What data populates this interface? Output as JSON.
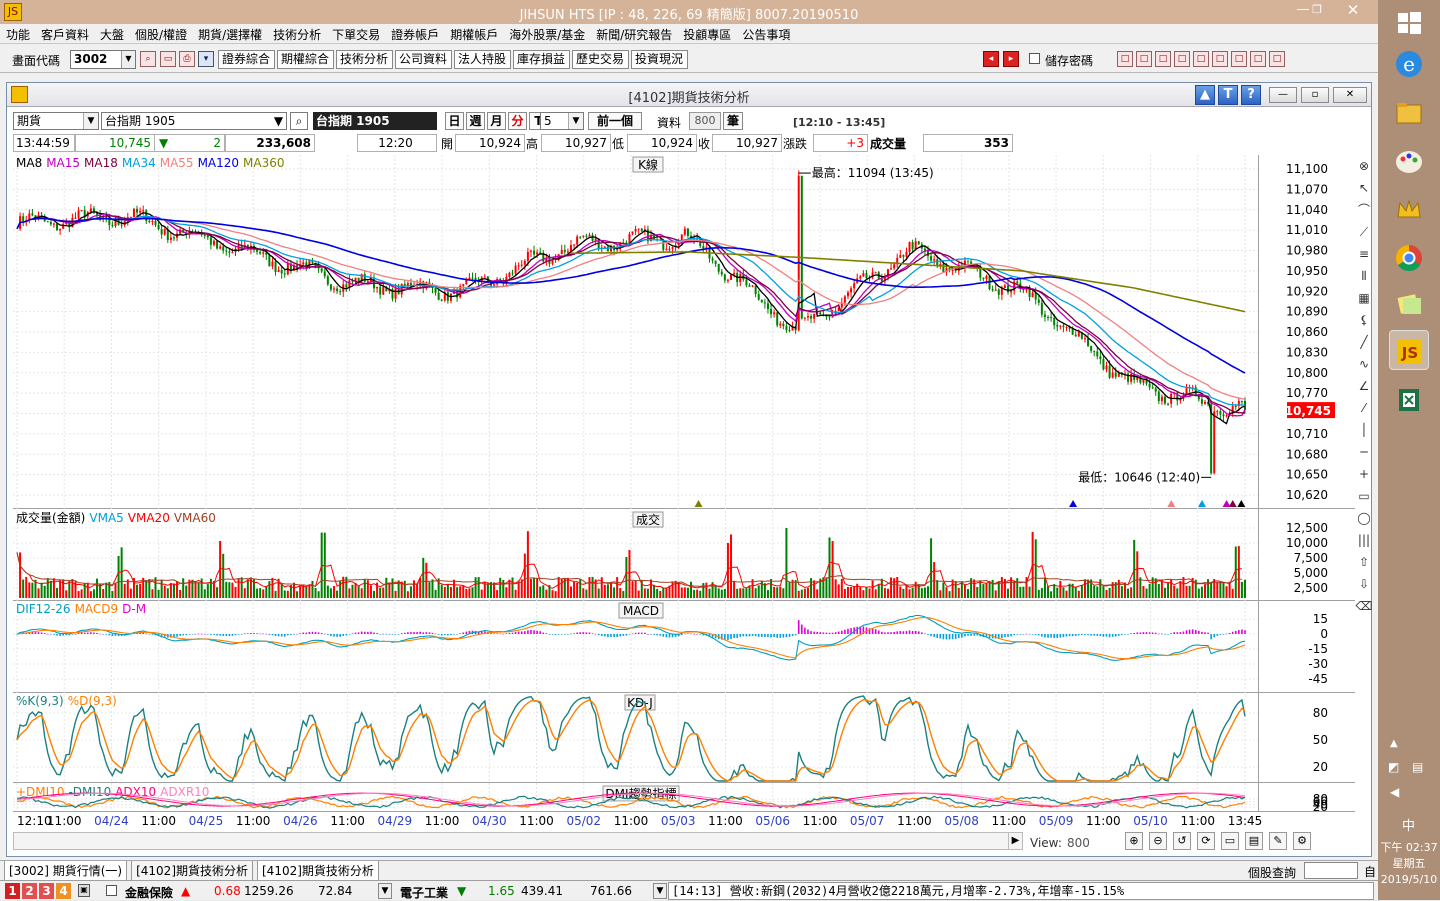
{
  "window": {
    "title": "JIHSUN HTS      [IP : 48, 226, 69 精簡版] 8007.20190510",
    "logo": "JS"
  },
  "menu": [
    "功能",
    "客戶資料",
    "大盤",
    "個股/權證",
    "期貨/選擇權",
    "技術分析",
    "下單交易",
    "證券帳戶",
    "期權帳戶",
    "海外股票/基金",
    "新聞/研究報告",
    "投顧專區",
    "公告事項"
  ],
  "toolbar": {
    "code_label": "畫面代碼",
    "code_value": "3002",
    "buttons": [
      "證券綜合",
      "期權綜合",
      "技術分析",
      "公司資料",
      "法人持股",
      "庫存損益",
      "歷史交易",
      "投資現況"
    ],
    "save_password": "儲存密碼"
  },
  "child": {
    "title": "[4102]期貨技術分析",
    "help_icons": [
      "▲",
      "T",
      "?"
    ]
  },
  "controls": {
    "market": "期貨",
    "symbol": "台指期 1905",
    "symbol_display": "台指期 1905",
    "periods": [
      "日",
      "週",
      "月",
      "分",
      "T"
    ],
    "active_period": "分",
    "interval": "5",
    "prev": "前一個",
    "data_label": "資料",
    "data_count": "800",
    "unit": "筆",
    "time_range": "[12:10 - 13:45]"
  },
  "quote": {
    "time": "13:44:59",
    "price": "10,745",
    "change_arrow": "▼",
    "change": "2",
    "volume": "233,608",
    "bar_time": "12:20",
    "open_label": "開",
    "open": "10,924",
    "high_label": "高",
    "high": "10,927",
    "low_label": "低",
    "low": "10,924",
    "close_label": "收",
    "close": "10,927",
    "chg_label": "漲跌",
    "chg": "+3",
    "vol_label": "成交量",
    "vol": "353"
  },
  "colors": {
    "up": "#ff0000",
    "down": "#008000",
    "ma8": "#000000",
    "ma15": "#c000c0",
    "ma18": "#800040",
    "ma34": "#00a0e0",
    "ma55": "#f08080",
    "ma120": "#0000e0",
    "ma360": "#808000",
    "dif": "#00a0c0",
    "macd": "#ff8000",
    "k": "#1a8080",
    "d": "#ff8000",
    "pdi": "#ff8000",
    "mdi": "#1a8080",
    "adx": "#ff0080",
    "adxr": "#ff80c0"
  },
  "panels": {
    "kline": {
      "title": "K線",
      "legend": [
        "MA8",
        "MA15",
        "MA18",
        "MA34",
        "MA55",
        "MA120",
        "MA360"
      ],
      "yticks": [
        "11,100",
        "11,070",
        "11,040",
        "11,010",
        "10,980",
        "10,950",
        "10,920",
        "10,890",
        "10,860",
        "10,830",
        "10,800",
        "10,770",
        "10,740",
        "10,710",
        "10,680",
        "10,650",
        "10,620"
      ],
      "high_note": "最高：11094 (13:45)",
      "low_note": "最低：10646 (12:40)",
      "last": "10,745"
    },
    "volume": {
      "title": "成交",
      "legend": [
        "成交量(金額)",
        "VMA5",
        "VMA20",
        "VMA60"
      ],
      "yticks": [
        "12,500",
        "10,000",
        "7,500",
        "5,000",
        "2,500"
      ]
    },
    "macd": {
      "title": "MACD",
      "legend": [
        "DIF12-26",
        "MACD9",
        "D-M"
      ],
      "yticks": [
        "15",
        "0",
        "-15",
        "-30",
        "-45"
      ]
    },
    "kd": {
      "title": "KD-J",
      "legend": [
        "%K(9,3)",
        "%D(9,3)"
      ],
      "yticks": [
        "80",
        "50",
        "20"
      ]
    },
    "dmi": {
      "title": "DMI趨勢指標",
      "legend": [
        "+DMI10",
        "-DMI10",
        "ADX10",
        "ADXR10"
      ],
      "yticks": [
        "80",
        "60",
        "40",
        "20"
      ]
    }
  },
  "xaxis": [
    "12:10",
    "11:00",
    "04/24",
    "11:00",
    "04/25",
    "11:00",
    "04/26",
    "11:00",
    "04/29",
    "11:00",
    "04/30",
    "11:00",
    "05/02",
    "11:00",
    "05/03",
    "11:00",
    "05/06",
    "11:00",
    "05/07",
    "11:00",
    "05/08",
    "11:00",
    "05/09",
    "11:00",
    "05/10",
    "11:00",
    "13:45"
  ],
  "bottom": {
    "view_label": "View: ",
    "view_value": "800"
  },
  "tabs": [
    "[3002] 期貨行情(一)",
    "[4102]期貨技術分析",
    "[4102]期貨技術分析"
  ],
  "tabs_right": {
    "label": "個股查詢",
    "extra": "自"
  },
  "status": {
    "digits": [
      "1",
      "2",
      "3",
      "4"
    ],
    "s1_name": "金融保險",
    "s1_arrow": "▲",
    "s1_chg": "0.68",
    "s1_idx": "1259.26",
    "s1_vol": "72.84",
    "s2_name": "電子工業",
    "s2_arrow": "▼",
    "s2_chg": "1.65",
    "s2_idx": "439.41",
    "s2_vol": "761.66",
    "news": "[14:13] 營收:新鋼(2032)4月營收2億2218萬元,月增率-2.73%,年增率-15.15%"
  },
  "clock": {
    "ime": "中",
    "time": "下午 02:37",
    "weekday": "星期五",
    "date": "2019/5/10"
  },
  "chart_data": {
    "type": "line",
    "title": "K線",
    "x": [
      "04/24",
      "04/25",
      "04/26",
      "04/29",
      "04/30",
      "05/02",
      "05/03",
      "05/06",
      "05/07",
      "05/08",
      "05/09",
      "05/10"
    ],
    "series": [
      {
        "name": "close",
        "values": [
          11020,
          11030,
          10980,
          10930,
          10920,
          10990,
          11000,
          10860,
          10980,
          10920,
          10780,
          10745
        ]
      },
      {
        "name": "MA120",
        "values": [
          11010,
          11000,
          10990,
          10960,
          10930,
          10945,
          10960,
          10900,
          10935,
          10920,
          10830,
          10760
        ]
      },
      {
        "name": "MA360",
        "values": [
          10970,
          10972,
          10973,
          10974,
          10975,
          10976,
          10978,
          10970,
          10960,
          10950,
          10925,
          10890
        ]
      }
    ],
    "ylim": [
      10620,
      11100
    ],
    "high": 11094,
    "low": 10646,
    "last": 10745
  }
}
